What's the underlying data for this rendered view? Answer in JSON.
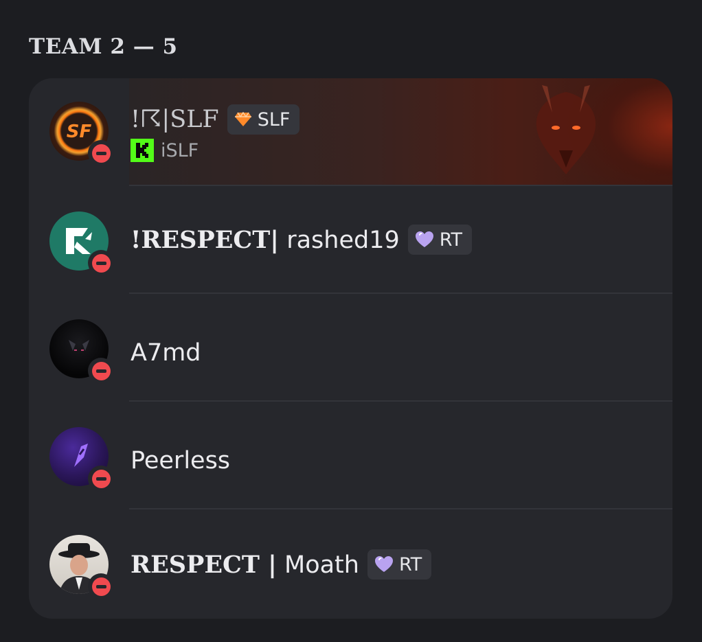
{
  "section": {
    "title": "TEAM 2 — 5"
  },
  "members": [
    {
      "name": "!☈|SLF",
      "tag": "SLF",
      "tag_icon": "orange-gem-icon",
      "activity_icon": "kick-icon",
      "activity": "iSLF",
      "status": "dnd"
    },
    {
      "name_prefix": "!RESPECT|",
      "name": "rashed19",
      "tag": "RT",
      "tag_icon": "purple-heart-icon",
      "status": "dnd"
    },
    {
      "name": "A7md",
      "status": "dnd"
    },
    {
      "name": "Peerless",
      "status": "dnd"
    },
    {
      "name_prefix": "RESPECT |",
      "name": "Moath",
      "tag": "RT",
      "tag_icon": "purple-heart-icon",
      "status": "dnd"
    }
  ],
  "colors": {
    "background": "#1c1d21",
    "card": "#26272c",
    "dnd": "#f04a4f",
    "kick_green": "#53fc18"
  }
}
